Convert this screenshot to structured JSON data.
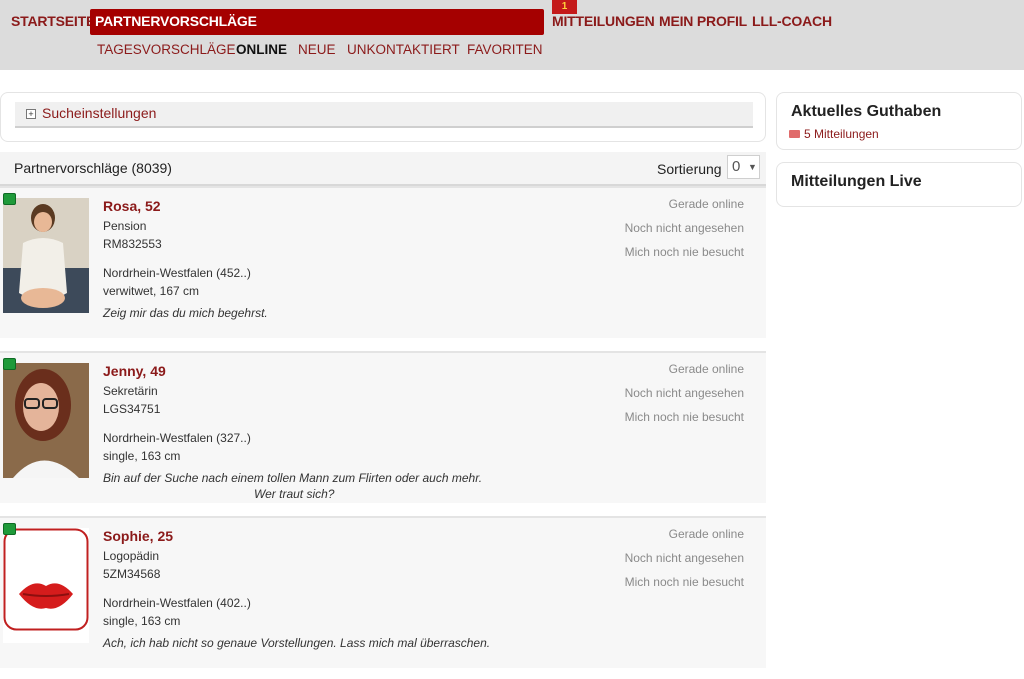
{
  "nav": {
    "items": [
      "STARTSEITE",
      "PARTNERVORSCHLÄGE",
      "MITTEILUNGEN",
      "MEIN PROFIL",
      "LLL-COACH"
    ],
    "badge": "1",
    "sub": [
      "TAGESVORSCHLÄGE",
      "ONLINE",
      "NEUE",
      "UNKONTAKTIERT",
      "FAVORITEN"
    ]
  },
  "search": {
    "label": "Sucheinstellungen"
  },
  "list": {
    "title": "Partnervorschläge (8039)",
    "sort_label": "Sortierung",
    "sort_value": "0"
  },
  "profiles": [
    {
      "name": "Rosa, 52",
      "job": "Pension",
      "code": "RM832553",
      "region": "Nordrhein-Westfalen (452..)",
      "status": "verwitwet, 167 cm",
      "quote": "Zeig mir das du mich begehrst.",
      "quote2": "",
      "online": "Gerade online",
      "seen": "Noch nicht angesehen",
      "visited": "Mich noch nie besucht"
    },
    {
      "name": "Jenny, 49",
      "job": "Sekretärin",
      "code": "LGS34751",
      "region": "Nordrhein-Westfalen (327..)",
      "status": "single, 163 cm",
      "quote": "Bin auf der Suche nach einem tollen Mann zum Flirten oder auch mehr.",
      "quote2": "Wer traut sich?",
      "online": "Gerade online",
      "seen": "Noch nicht angesehen",
      "visited": "Mich noch nie besucht"
    },
    {
      "name": "Sophie, 25",
      "job": "Logopädin",
      "code": "5ZM34568",
      "region": "Nordrhein-Westfalen (402..)",
      "status": "single, 163 cm",
      "quote": "Ach, ich hab nicht so genaue Vorstellungen. Lass mich mal überraschen.",
      "quote2": "",
      "online": "Gerade online",
      "seen": "Noch nicht angesehen",
      "visited": "Mich noch nie besucht"
    }
  ],
  "sidebar": {
    "balance_title": "Aktuelles Guthaben",
    "messages_link": "5 Mitteilungen",
    "live_title": "Mitteilungen Live"
  },
  "colors": {
    "brand": "#8b1a1a",
    "active": "#a50000",
    "online": "#1f9a3a"
  }
}
